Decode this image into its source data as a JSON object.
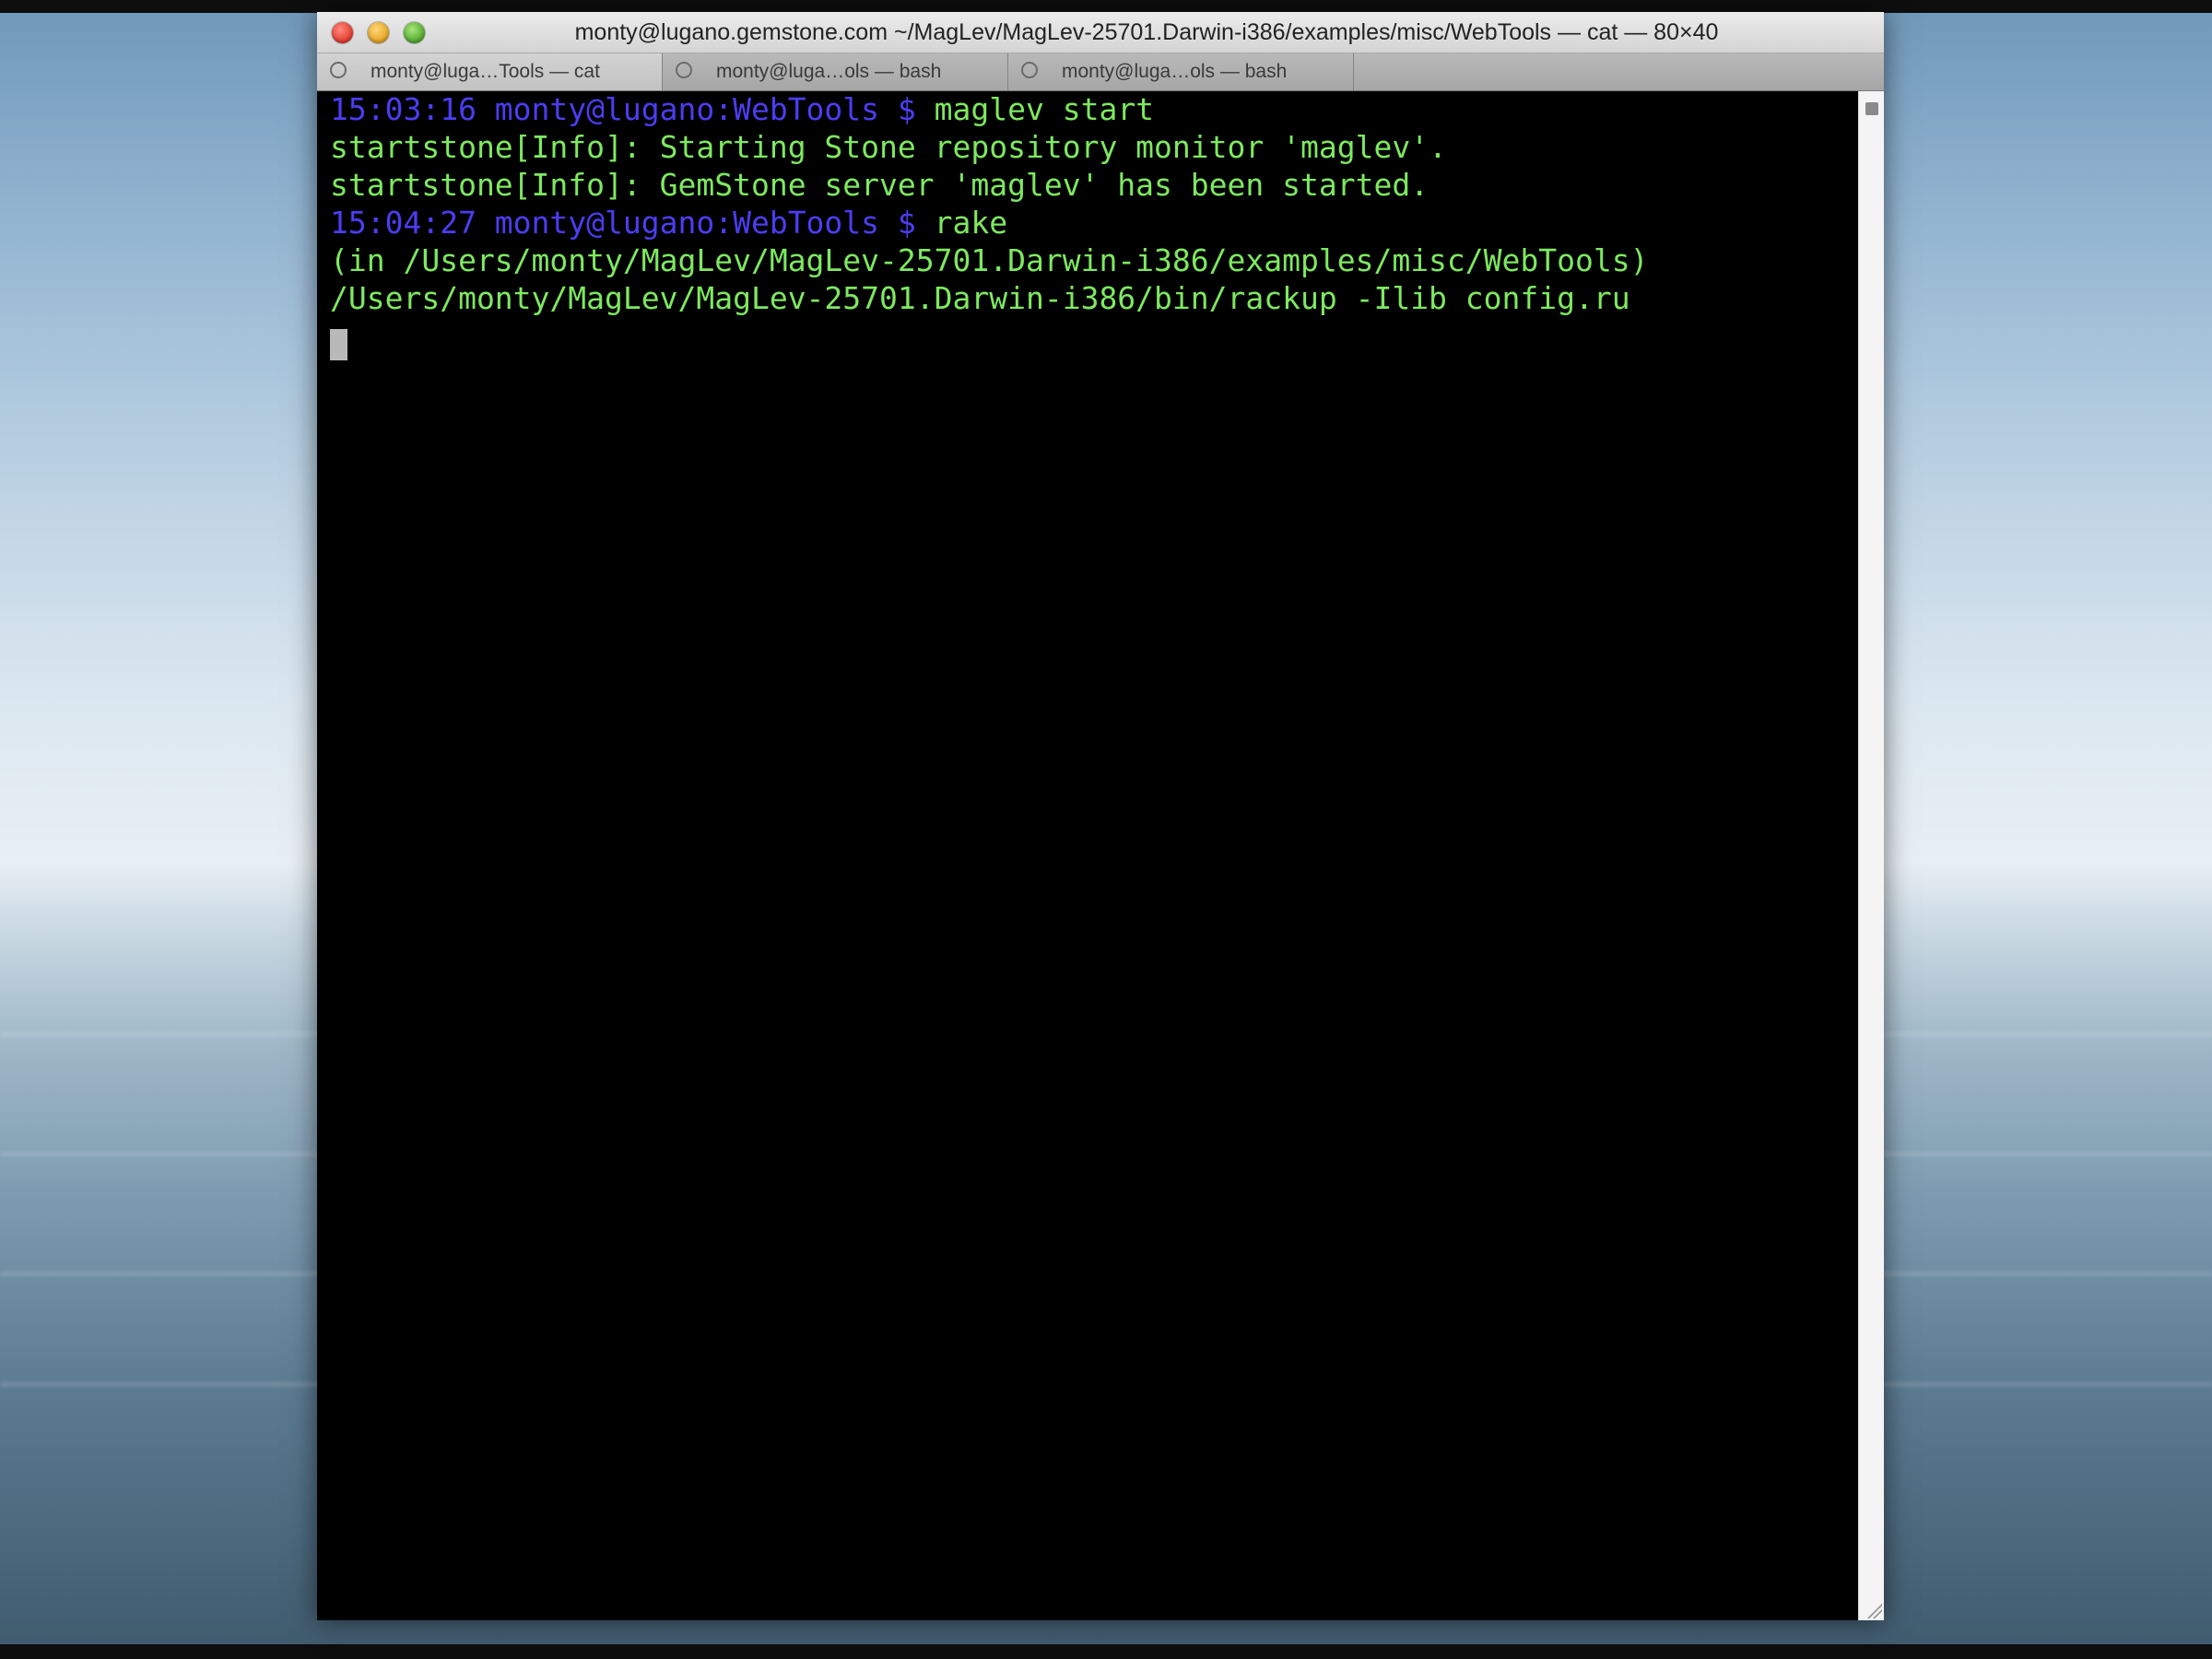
{
  "window": {
    "title": "monty@lugano.gemstone.com ~/MagLev/MagLev-25701.Darwin-i386/examples/misc/WebTools — cat — 80×40"
  },
  "tabs": [
    {
      "label": "monty@luga…Tools — cat",
      "active": true
    },
    {
      "label": "monty@luga…ols — bash",
      "active": false
    },
    {
      "label": "monty@luga…ols — bash",
      "active": false
    }
  ],
  "terminal": {
    "lines": [
      {
        "prompt": "15:03:16 monty@lugano:WebTools $ ",
        "text": "maglev start"
      },
      {
        "prompt": "",
        "text": "startstone[Info]: Starting Stone repository monitor 'maglev'."
      },
      {
        "prompt": "",
        "text": "startstone[Info]: GemStone server 'maglev' has been started."
      },
      {
        "prompt": "15:04:27 monty@lugano:WebTools $ ",
        "text": "rake"
      },
      {
        "prompt": "",
        "text": "(in /Users/monty/MagLev/MagLev-25701.Darwin-i386/examples/misc/WebTools)"
      },
      {
        "prompt": "",
        "text": "/Users/monty/MagLev/MagLev-25701.Darwin-i386/bin/rackup -Ilib config.ru"
      }
    ]
  },
  "colors": {
    "prompt": "#4b3df2",
    "output": "#7ee860",
    "background": "#000000"
  },
  "icons": {
    "close": "close-button-icon",
    "minimize": "minimize-button-icon",
    "zoom": "zoom-button-icon",
    "tab_close": "tab-close-icon"
  }
}
